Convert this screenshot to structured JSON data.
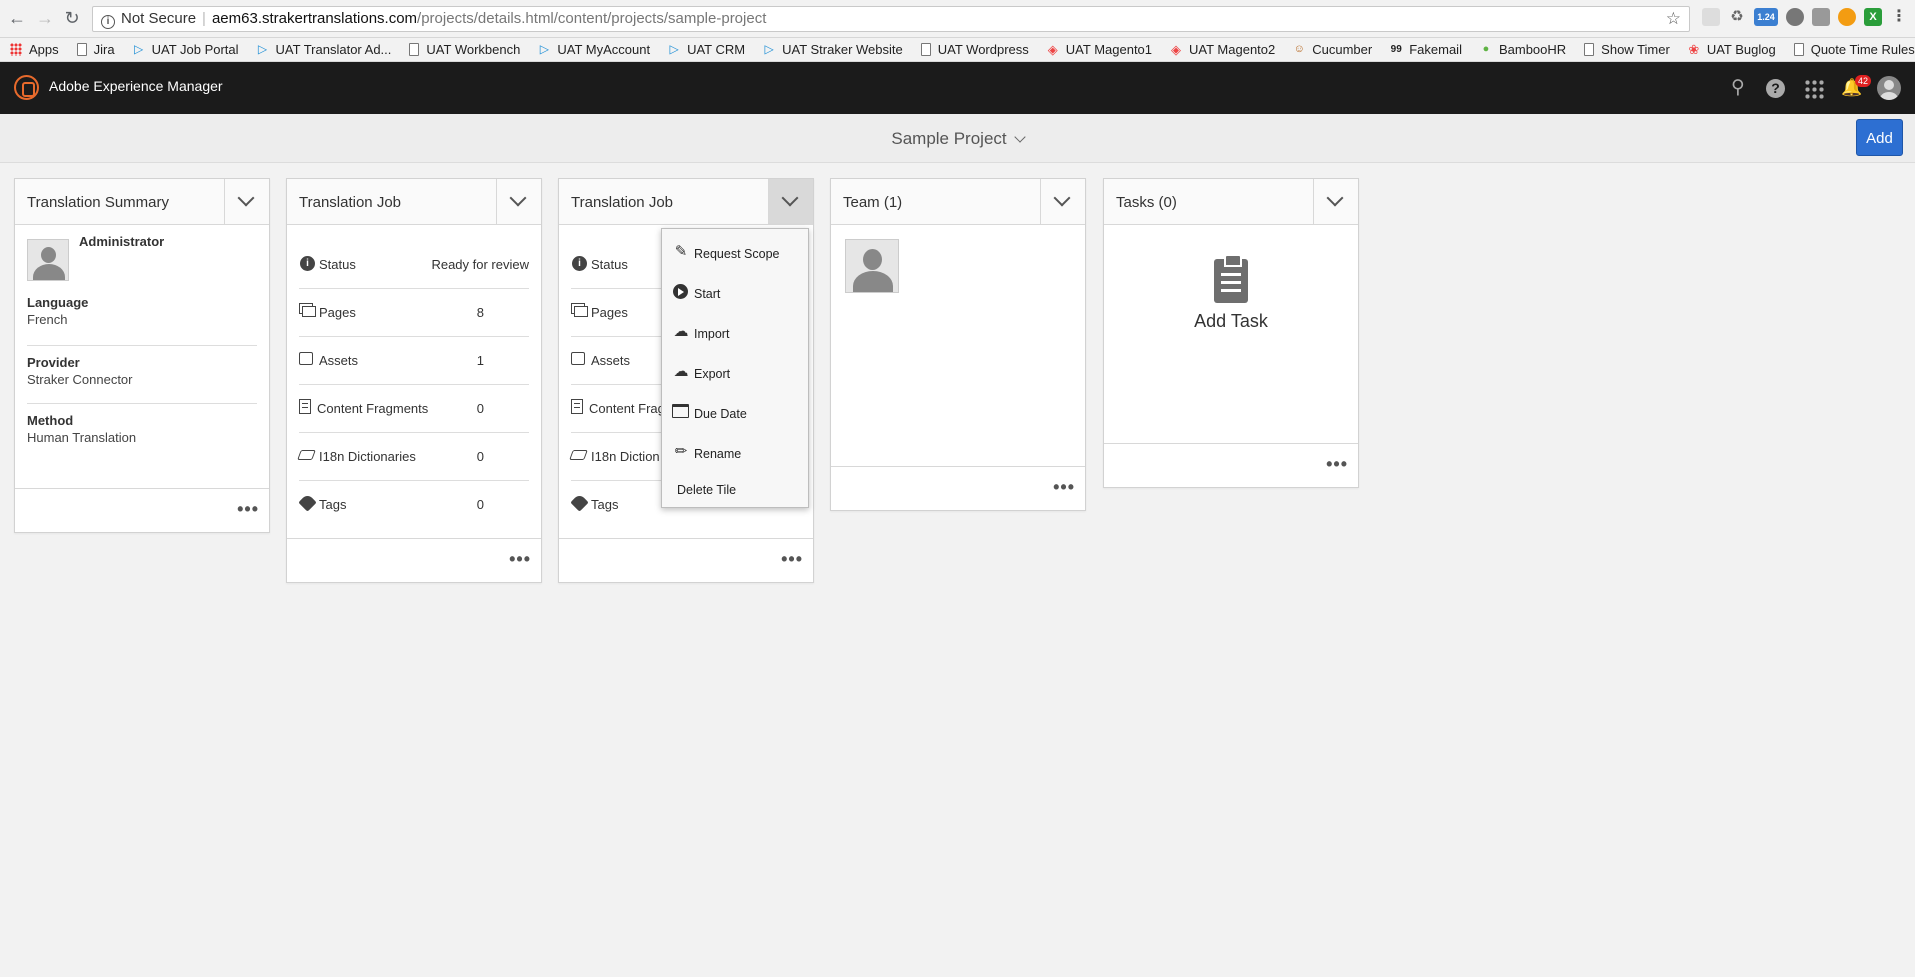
{
  "browser": {
    "security": "Not Secure",
    "url_host": "aem63.strakertranslations.com",
    "url_path": "/projects/details.html/content/projects/sample-project",
    "ext_badge": "1.24"
  },
  "bookmarks": [
    {
      "label": "Apps",
      "icon": "apps-grid"
    },
    {
      "label": "Jira",
      "icon": "page"
    },
    {
      "label": "UAT Job Portal",
      "icon": "triangle"
    },
    {
      "label": "UAT Translator Ad...",
      "icon": "triangle"
    },
    {
      "label": "UAT Workbench",
      "icon": "page"
    },
    {
      "label": "UAT MyAccount",
      "icon": "triangle"
    },
    {
      "label": "UAT CRM",
      "icon": "triangle"
    },
    {
      "label": "UAT Straker Website",
      "icon": "triangle"
    },
    {
      "label": "UAT Wordpress",
      "icon": "page"
    },
    {
      "label": "UAT Magento1",
      "icon": "magento"
    },
    {
      "label": "UAT Magento2",
      "icon": "magento"
    },
    {
      "label": "Cucumber",
      "icon": "cucumber"
    },
    {
      "label": "Fakemail",
      "icon": "fakemail"
    },
    {
      "label": "BambooHR",
      "icon": "bamboo"
    },
    {
      "label": "Show Timer",
      "icon": "page"
    },
    {
      "label": "UAT Buglog",
      "icon": "bug"
    },
    {
      "label": "Quote Time Rules T...",
      "icon": "page"
    }
  ],
  "header": {
    "app_title": "Adobe Experience Manager",
    "notification_count": "42"
  },
  "project": {
    "title": "Sample Project",
    "add_label": "Add"
  },
  "summary": {
    "title": "Translation Summary",
    "user": "Administrator",
    "language_label": "Language",
    "language": "French",
    "provider_label": "Provider",
    "provider": "Straker Connector",
    "method_label": "Method",
    "method": "Human Translation"
  },
  "job1": {
    "title": "Translation Job",
    "rows": [
      {
        "label": "Status",
        "value": "Ready for review"
      },
      {
        "label": "Pages",
        "value": "8"
      },
      {
        "label": "Assets",
        "value": "1"
      },
      {
        "label": "Content Fragments",
        "value": "0"
      },
      {
        "label": "I18n Dictionaries",
        "value": "0"
      },
      {
        "label": "Tags",
        "value": "0"
      }
    ]
  },
  "job2": {
    "title": "Translation Job",
    "rows": [
      {
        "label": "Status"
      },
      {
        "label": "Pages"
      },
      {
        "label": "Assets"
      },
      {
        "label": "Content Frag"
      },
      {
        "label": "I18n Diction"
      },
      {
        "label": "Tags"
      }
    ]
  },
  "menu": {
    "items": [
      {
        "label": "Request Scope",
        "icon": "pen-icon"
      },
      {
        "label": "Start",
        "icon": "play-icon"
      },
      {
        "label": "Import",
        "icon": "cloud-upload-icon"
      },
      {
        "label": "Export",
        "icon": "cloud-download-icon"
      },
      {
        "label": "Due Date",
        "icon": "calendar-icon"
      },
      {
        "label": "Rename",
        "icon": "pencil-icon"
      },
      {
        "label": "Delete Tile",
        "icon": ""
      }
    ]
  },
  "team": {
    "title": "Team (1)"
  },
  "tasks": {
    "title": "Tasks (0)",
    "add_task": "Add Task"
  }
}
